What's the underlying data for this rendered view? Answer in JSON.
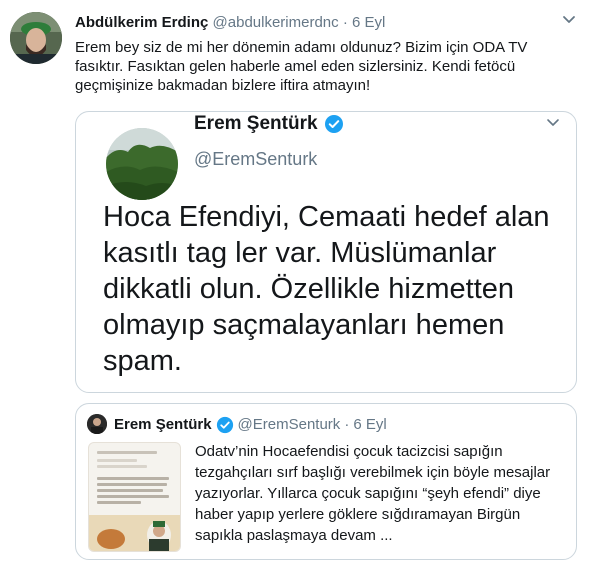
{
  "tweet": {
    "author_name": "Abdülkerim Erdinç",
    "author_handle": "@abdulkerimerdnc",
    "separator": "·",
    "date": "6 Eyl",
    "text": "Erem bey siz de mi her dönemin adamı oldunuz? Bizim için ODA TV fasıktır. Fasıktan gelen haberle amel eden sizlersiniz. Kendi fetöcü geçmişinize bakmadan bizlere iftira atmayın!"
  },
  "embedded_screenshot": {
    "author_name": "Erem Şentürk",
    "author_handle": "@EremSenturk",
    "text": "Hoca Efendiyi, Cemaati hedef alan kasıtlı tag ler var. Müslümanlar dikkatli olun. Özellikle hizmetten olmayıp saçmalayanları hemen spam."
  },
  "quoted_tweet": {
    "author_name": "Erem Şentürk",
    "author_handle": "@EremSenturk",
    "separator": "·",
    "date": "6 Eyl",
    "text": "Odatv’nin Hocaefendisi çocuk tacizcisi sapığın tezgahçıları sırf başlığı verebilmek için böyle mesajlar yazıyorlar. Yıllarca çocuk sapığını “şeyh efendi” diye haber yapıp yerlere göklere sığdıramayan Birgün sapıkla paslaşmaya devam ..."
  },
  "colors": {
    "text": "#14171a",
    "muted": "#657786",
    "border": "#ccd6dd",
    "verified": "#1da1f2"
  },
  "icons": {
    "caret": "chevron-down-icon",
    "verified": "verified-badge-icon"
  }
}
